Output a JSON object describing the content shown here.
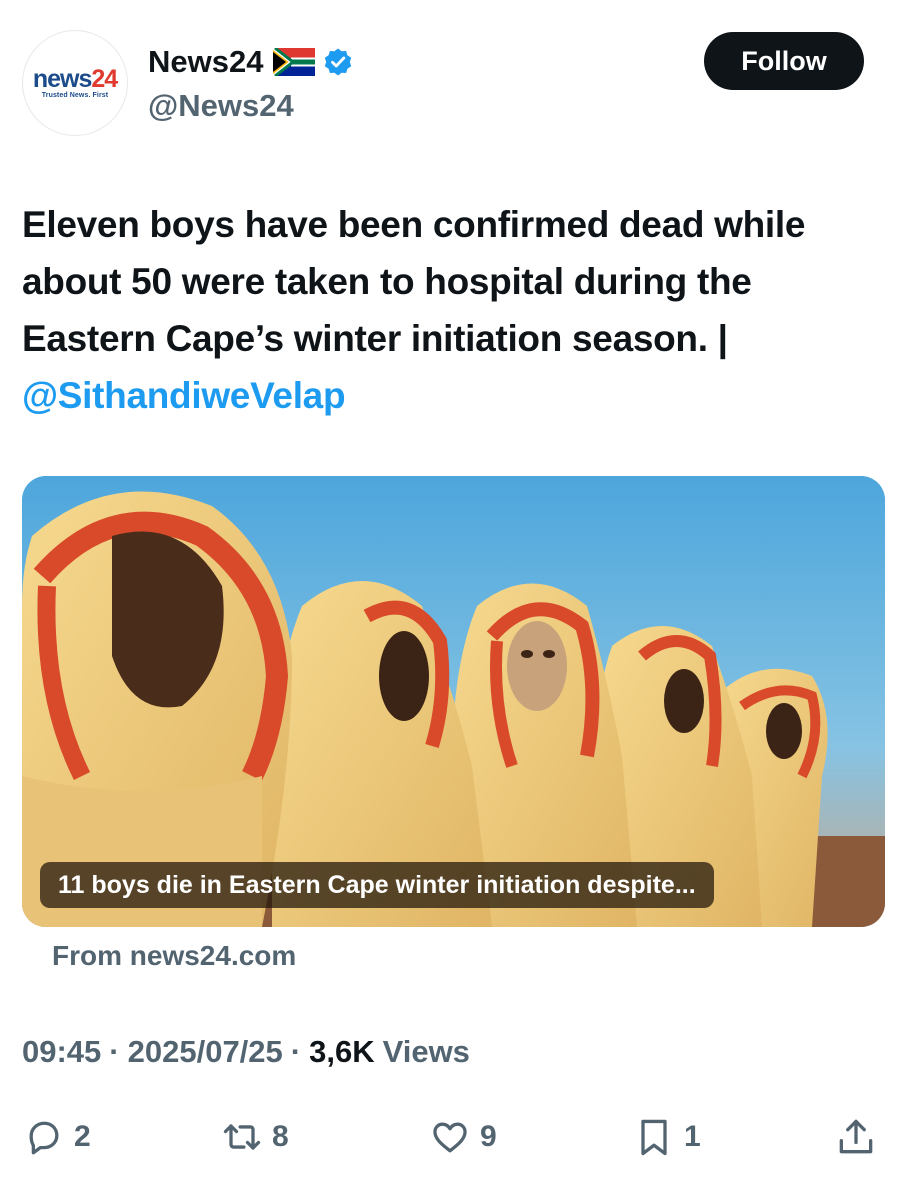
{
  "account": {
    "logo_word_1": "news",
    "logo_word_2": "24",
    "logo_tagline": "Trusted News. First",
    "display_name": "News24",
    "handle": "@News24",
    "flag_icon": "south-africa-flag-icon",
    "verified_icon": "verified-badge-icon"
  },
  "follow_label": "Follow",
  "tweet": {
    "text": "Eleven boys have been confirmed dead while about 50 were taken to hospital during the Eastern Cape’s winter initiation season. | ",
    "mention": "@SithandiweVelap"
  },
  "card": {
    "caption": "11 boys die in Eastern Cape winter initiation despite...",
    "source": "From news24.com"
  },
  "meta": {
    "time": "09:45",
    "date": "2025/07/25",
    "views_count": "3,6K",
    "views_label": "Views"
  },
  "actions": {
    "replies": "2",
    "reposts": "8",
    "likes": "9",
    "bookmarks": "1"
  },
  "colors": {
    "accent": "#1d9bf0",
    "text": "#0f1419",
    "muted": "#536471",
    "button": "#0f1419"
  }
}
